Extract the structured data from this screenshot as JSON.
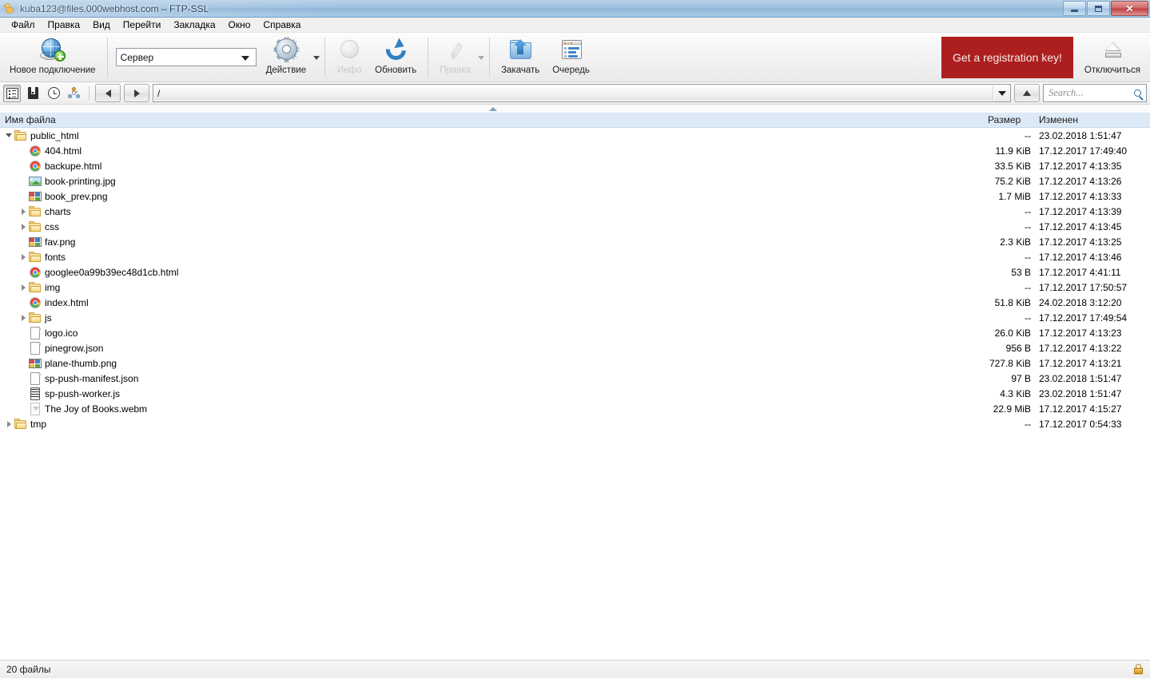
{
  "window": {
    "title": "kuba123@files.000webhost.com – FTP-SSL",
    "app_icon": "duck-icon",
    "controls": {
      "minimize": "Minimize",
      "restore": "Restore",
      "close": "Close"
    }
  },
  "menubar": [
    {
      "label": "Файл"
    },
    {
      "label": "Правка"
    },
    {
      "label": "Вид"
    },
    {
      "label": "Перейти"
    },
    {
      "label": "Закладка"
    },
    {
      "label": "Окно"
    },
    {
      "label": "Справка"
    }
  ],
  "toolbar": {
    "new_connection": {
      "label": "Новое подключение",
      "icon": "globe-plus-icon",
      "enabled": true
    },
    "server_select": {
      "value": "Сервер",
      "icon": "chevron-down-icon"
    },
    "action": {
      "label": "Действие",
      "icon": "gear-icon",
      "enabled": true,
      "has_menu": true
    },
    "info": {
      "label": "Инфо",
      "icon": "info-icon",
      "enabled": false
    },
    "refresh": {
      "label": "Обновить",
      "icon": "refresh-icon",
      "enabled": true
    },
    "edit": {
      "label": "Правка",
      "icon": "pencil-icon",
      "enabled": false,
      "has_menu": true
    },
    "upload": {
      "label": "Закачать",
      "icon": "upload-folder-icon",
      "enabled": true
    },
    "queue": {
      "label": "Очередь",
      "icon": "queue-window-icon",
      "enabled": true
    },
    "registration": {
      "label": "Get a registration key!",
      "color": "#ad1f1f",
      "text_color": "#f5ecec"
    },
    "disconnect": {
      "label": "Отключиться",
      "icon": "eject-icon",
      "enabled": true
    }
  },
  "navbar": {
    "view_browser": {
      "icon": "list-view-icon",
      "active": true
    },
    "bookmarks": {
      "icon": "bookmark-icon",
      "active": false
    },
    "history": {
      "icon": "clock-icon",
      "active": false
    },
    "transfers": {
      "icon": "nodes-icon",
      "active": false
    },
    "back": {
      "icon": "triangle-left-icon"
    },
    "forward": {
      "icon": "triangle-right-icon"
    },
    "path": {
      "value": "/",
      "icon": "chevron-down-icon"
    },
    "up": {
      "icon": "triangle-up-icon"
    },
    "search": {
      "placeholder": "Search...",
      "value": "",
      "icon": "search-icon"
    }
  },
  "columns": {
    "name": "Имя файла",
    "size": "Размер",
    "modified": "Изменен",
    "sort_by": "name",
    "sort_direction": "ascending"
  },
  "files": [
    {
      "name": "public_html",
      "icon": "folder-icon",
      "indent": 0,
      "disclosure": "open",
      "size": "--",
      "modified": "23.02.2018 1:51:47"
    },
    {
      "name": "404.html",
      "icon": "chrome-icon",
      "indent": 1,
      "disclosure": "none",
      "size": "11.9 KiB",
      "modified": "17.12.2017 17:49:40"
    },
    {
      "name": "backupe.html",
      "icon": "chrome-icon",
      "indent": 1,
      "disclosure": "none",
      "size": "33.5 KiB",
      "modified": "17.12.2017 4:13:35"
    },
    {
      "name": "book-printing.jpg",
      "icon": "photo-icon",
      "indent": 1,
      "disclosure": "none",
      "size": "75.2 KiB",
      "modified": "17.12.2017 4:13:26"
    },
    {
      "name": "book_prev.png",
      "icon": "png-icon",
      "indent": 1,
      "disclosure": "none",
      "size": "1.7 MiB",
      "modified": "17.12.2017 4:13:33"
    },
    {
      "name": "charts",
      "icon": "folder-icon",
      "indent": 1,
      "disclosure": "closed",
      "size": "--",
      "modified": "17.12.2017 4:13:39"
    },
    {
      "name": "css",
      "icon": "folder-icon",
      "indent": 1,
      "disclosure": "closed",
      "size": "--",
      "modified": "17.12.2017 4:13:45"
    },
    {
      "name": "fav.png",
      "icon": "png-icon",
      "indent": 1,
      "disclosure": "none",
      "size": "2.3 KiB",
      "modified": "17.12.2017 4:13:25"
    },
    {
      "name": "fonts",
      "icon": "folder-icon",
      "indent": 1,
      "disclosure": "closed",
      "size": "--",
      "modified": "17.12.2017 4:13:46"
    },
    {
      "name": "googlee0a99b39ec48d1cb.html",
      "icon": "chrome-icon",
      "indent": 1,
      "disclosure": "none",
      "size": "53 B",
      "modified": "17.12.2017 4:41:11"
    },
    {
      "name": "img",
      "icon": "folder-icon",
      "indent": 1,
      "disclosure": "closed",
      "size": "--",
      "modified": "17.12.2017 17:50:57"
    },
    {
      "name": "index.html",
      "icon": "chrome-icon",
      "indent": 1,
      "disclosure": "none",
      "size": "51.8 KiB",
      "modified": "24.02.2018 3:12:20"
    },
    {
      "name": "js",
      "icon": "folder-icon",
      "indent": 1,
      "disclosure": "closed",
      "size": "--",
      "modified": "17.12.2017 17:49:54"
    },
    {
      "name": "logo.ico",
      "icon": "doc-icon",
      "indent": 1,
      "disclosure": "none",
      "size": "26.0 KiB",
      "modified": "17.12.2017 4:13:23"
    },
    {
      "name": "pinegrow.json",
      "icon": "doc-icon",
      "indent": 1,
      "disclosure": "none",
      "size": "956 B",
      "modified": "17.12.2017 4:13:22"
    },
    {
      "name": "plane-thumb.png",
      "icon": "png-icon",
      "indent": 1,
      "disclosure": "none",
      "size": "727.8 KiB",
      "modified": "17.12.2017 4:13:21"
    },
    {
      "name": "sp-push-manifest.json",
      "icon": "doc-icon",
      "indent": 1,
      "disclosure": "none",
      "size": "97 B",
      "modified": "23.02.2018 1:51:47"
    },
    {
      "name": "sp-push-worker.js",
      "icon": "js-icon",
      "indent": 1,
      "disclosure": "none",
      "size": "4.3 KiB",
      "modified": "23.02.2018 1:51:47"
    },
    {
      "name": "The Joy of Books.webm",
      "icon": "media-icon",
      "indent": 1,
      "disclosure": "none",
      "size": "22.9 MiB",
      "modified": "17.12.2017 4:15:27"
    },
    {
      "name": "tmp",
      "icon": "folder-icon",
      "indent": 0,
      "disclosure": "closed",
      "size": "--",
      "modified": "17.12.2017 0:54:33"
    }
  ],
  "statusbar": {
    "file_count": "20 файлы",
    "security_icon": "lock-icon"
  }
}
